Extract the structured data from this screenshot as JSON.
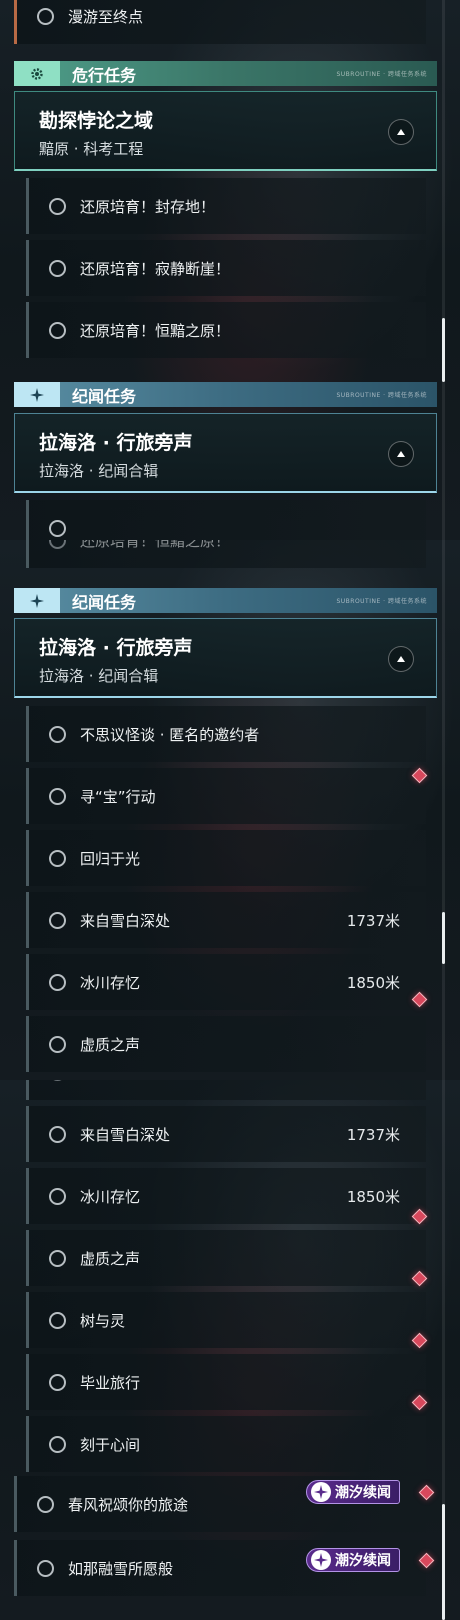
{
  "panel1": {
    "top_item": "漫游至终点",
    "cat_danger": {
      "label": "危行任务",
      "mark": "SUBROUTINE · 跨域任务系统"
    },
    "quest_danger": {
      "title": "勘探悖论之域",
      "subtitle": "黯原 · 科考工程"
    },
    "danger_items": [
      "还原培育！封存地！",
      "还原培育！寂静断崖！",
      "还原培育！恒黯之原！"
    ],
    "cat_lore": {
      "label": "纪闻任务",
      "mark": "SUBROUTINE · 跨域任务系统"
    },
    "quest_lore": {
      "title": "拉海洛 · 行旅旁声",
      "subtitle": "拉海洛 · 纪闻合辑"
    }
  },
  "panel2": {
    "partial_top": "还原培育！恒黯之原！",
    "cat_lore": {
      "label": "纪闻任务",
      "mark": "SUBROUTINE · 跨域任务系统"
    },
    "quest_lore": {
      "title": "拉海洛 · 行旅旁声",
      "subtitle": "拉海洛 · 纪闻合辑"
    },
    "items": [
      {
        "title": "不思议怪谈 · 匿名的邀约者",
        "dist": ""
      },
      {
        "title": "寻“宝”行动",
        "dist": ""
      },
      {
        "title": "回归于光",
        "dist": ""
      },
      {
        "title": "来自雪白深处",
        "dist": "1737米"
      },
      {
        "title": "冰川存忆",
        "dist": "1850米"
      },
      {
        "title": "虚质之声",
        "dist": ""
      }
    ]
  },
  "panel3": {
    "items": [
      {
        "title": "来自雪白深处",
        "dist": "1737米"
      },
      {
        "title": "冰川存忆",
        "dist": "1850米"
      },
      {
        "title": "虚质之声",
        "dist": ""
      },
      {
        "title": "树与灵",
        "dist": ""
      },
      {
        "title": "毕业旅行",
        "dist": ""
      },
      {
        "title": "刻于心间",
        "dist": ""
      }
    ],
    "tide_items": [
      {
        "title": "春风祝颂你的旅途",
        "badge": "潮汐续闻"
      },
      {
        "title": "如那融雪所愿般",
        "badge": "潮汐续闻"
      }
    ]
  },
  "colors": {
    "danger_accent": "#4f9f8a",
    "lore_accent": "#5a8fa4",
    "marker": "#d8485c",
    "badge": "#5a2b8c"
  },
  "icons": {
    "danger": "gear-icon",
    "lore": "sparkle-icon",
    "marker": "diamond-marker-icon",
    "badge": "tide-icon"
  }
}
